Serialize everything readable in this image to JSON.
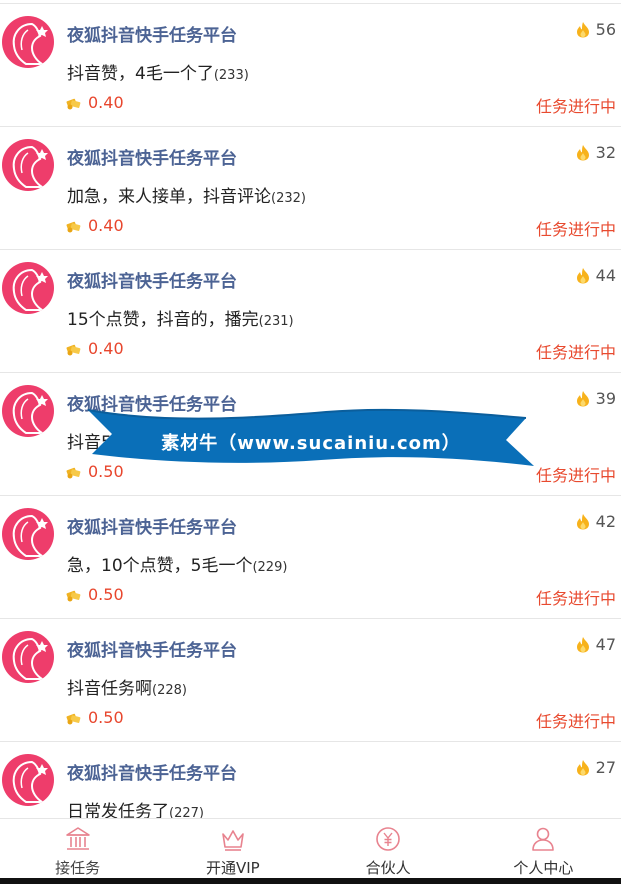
{
  "colors": {
    "title": "#4c6394",
    "price": "#e8462d",
    "status": "#e84a2f",
    "avatar": "#ee3d6b",
    "banner": "#0a6fb8",
    "tab_icon": "#e8838f"
  },
  "tasks": [
    {
      "platform": "夜狐抖音快手任务平台",
      "desc": "抖音赞，4毛一个了",
      "id": "(233)",
      "heat": "56",
      "price": "0.40",
      "status": "任务进行中"
    },
    {
      "platform": "夜狐抖音快手任务平台",
      "desc": "加急，来人接单，抖音评论",
      "id": "(232)",
      "heat": "32",
      "price": "0.40",
      "status": "任务进行中"
    },
    {
      "platform": "夜狐抖音快手任务平台",
      "desc": "15个点赞，抖音的，播完",
      "id": "(231)",
      "heat": "44",
      "price": "0.40",
      "status": "任务进行中"
    },
    {
      "platform": "夜狐抖音快手任务平台",
      "desc": "抖音5",
      "id": "",
      "heat": "39",
      "price": "0.50",
      "status": "任务进行中"
    },
    {
      "platform": "夜狐抖音快手任务平台",
      "desc": "急，10个点赞，5毛一个",
      "id": "(229)",
      "heat": "42",
      "price": "0.50",
      "status": "任务进行中"
    },
    {
      "platform": "夜狐抖音快手任务平台",
      "desc": "抖音任务啊",
      "id": "(228)",
      "heat": "47",
      "price": "0.50",
      "status": "任务进行中"
    },
    {
      "platform": "夜狐抖音快手任务平台",
      "desc": "日常发任务了",
      "id": "(227)",
      "heat": "27",
      "price": "",
      "status": ""
    }
  ],
  "watermark": "素材牛（www.sucainiu.com）",
  "tabs": [
    {
      "label": "接任务",
      "icon": "bank-icon"
    },
    {
      "label": "开通VIP",
      "icon": "crown-icon"
    },
    {
      "label": "合伙人",
      "icon": "yuan-coin-icon"
    },
    {
      "label": "个人中心",
      "icon": "user-icon"
    }
  ]
}
